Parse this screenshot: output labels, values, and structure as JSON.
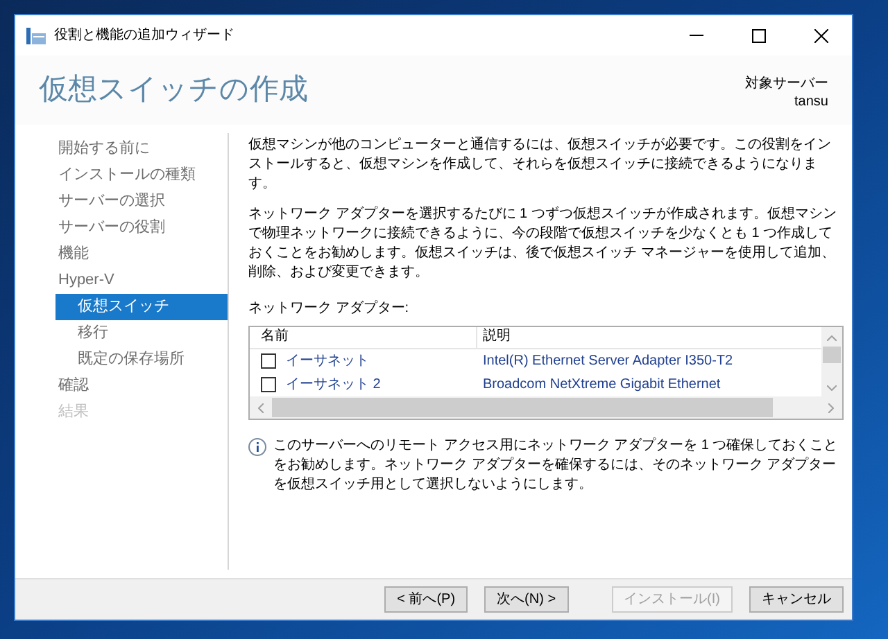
{
  "window": {
    "title": "役割と機能の追加ウィザード"
  },
  "header": {
    "title": "仮想スイッチの作成",
    "target_label": "対象サーバー",
    "target_server": "tansu"
  },
  "nav": [
    {
      "label": "開始する前に",
      "selected": false,
      "disabled": false
    },
    {
      "label": "インストールの種類",
      "selected": false,
      "disabled": false
    },
    {
      "label": "サーバーの選択",
      "selected": false,
      "disabled": false
    },
    {
      "label": "サーバーの役割",
      "selected": false,
      "disabled": false
    },
    {
      "label": "機能",
      "selected": false,
      "disabled": false
    },
    {
      "label": "Hyper-V",
      "selected": false,
      "disabled": false,
      "children": [
        {
          "label": "仮想スイッチ",
          "selected": true,
          "disabled": false
        },
        {
          "label": "移行",
          "selected": false,
          "disabled": false
        },
        {
          "label": "既定の保存場所",
          "selected": false,
          "disabled": false
        }
      ]
    },
    {
      "label": "確認",
      "selected": false,
      "disabled": false
    },
    {
      "label": "結果",
      "selected": false,
      "disabled": true
    }
  ],
  "paragraphs": [
    "仮想マシンが他のコンピューターと通信するには、仮想スイッチが必要です。この役割をインストールすると、仮想マシンを作成して、それらを仮想スイッチに接続できるようになります。",
    "ネットワーク アダプターを選択するたびに 1 つずつ仮想スイッチが作成されます。仮想マシンで物理ネットワークに接続できるように、今の段階で仮想スイッチを少なくとも 1 つ作成しておくことをお勧めします。仮想スイッチは、後で仮想スイッチ マネージャーを使用して追加、削除、および変更できます。"
  ],
  "adapters": {
    "label": "ネットワーク アダプター:",
    "columns": [
      "名前",
      "説明"
    ],
    "rows": [
      {
        "name": "イーサネット",
        "description": "Intel(R) Ethernet Server Adapter I350-T2",
        "checked": false
      },
      {
        "name": "イーサネット 2",
        "description": "Broadcom NetXtreme Gigabit Ethernet",
        "checked": false
      }
    ]
  },
  "info": "このサーバーへのリモート アクセス用にネットワーク アダプターを 1 つ確保しておくことをお勧めします。ネットワーク アダプターを確保するには、そのネットワーク アダプターを仮想スイッチ用として選択しないようにします。",
  "buttons": [
    {
      "label": "< 前へ(P)",
      "disabled": false
    },
    {
      "label": "次へ(N) >",
      "disabled": false
    },
    {
      "label": "インストール(I)",
      "disabled": true
    },
    {
      "label": "キャンセル",
      "disabled": false
    }
  ]
}
